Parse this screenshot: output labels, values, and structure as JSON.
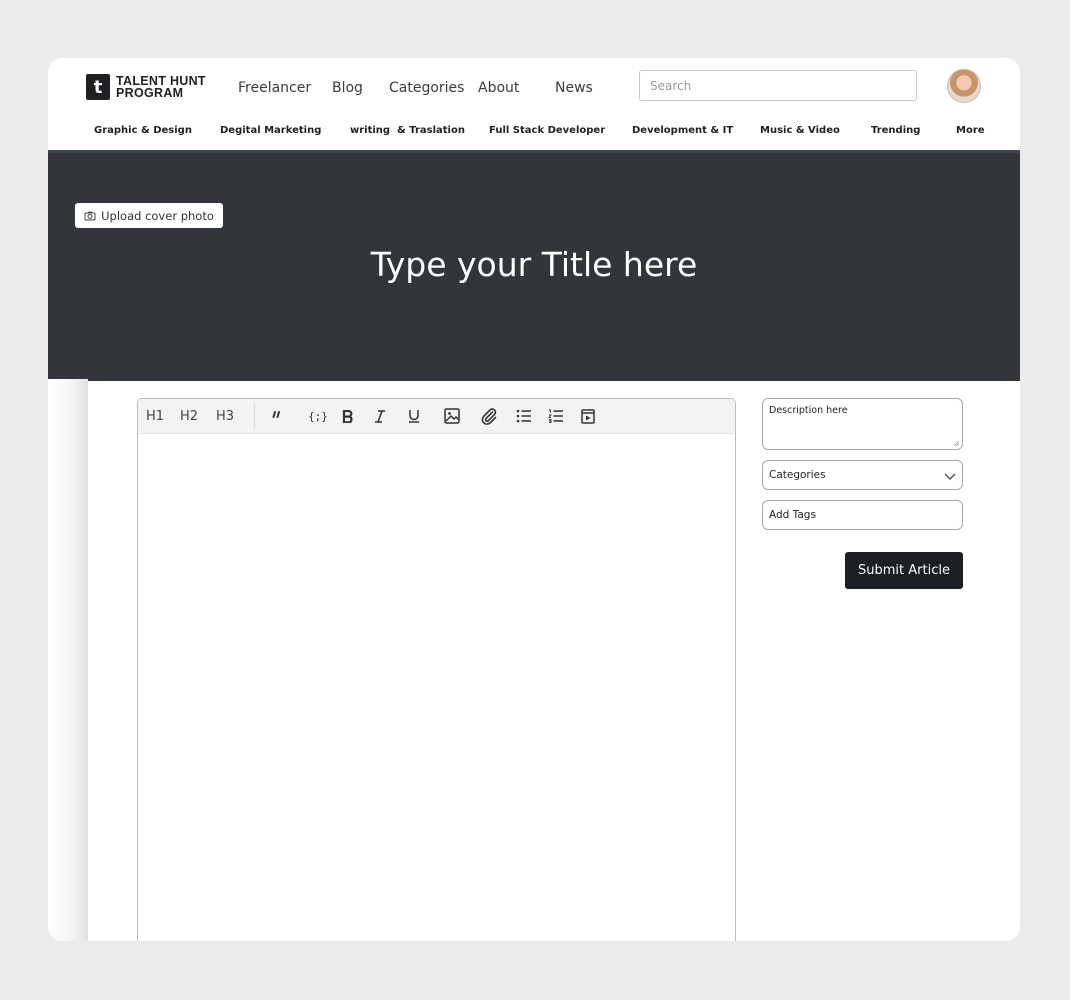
{
  "brand": {
    "mark": "t",
    "line1": "TALENT HUNT",
    "line2": "PROGRAM"
  },
  "nav": [
    "Freelancer",
    "Blog",
    "Categories",
    "About",
    "News"
  ],
  "search": {
    "placeholder": "Search"
  },
  "categories": [
    "Graphic & Design",
    "Degital Marketing",
    "writing  & Traslation",
    "Full Stack Developer",
    "Development & IT",
    "Music & Video",
    "Trending",
    "More"
  ],
  "cover": {
    "upload_label": "Upload cover photo",
    "title_placeholder": "Type your Title here"
  },
  "toolbar": {
    "h1": "H1",
    "h2": "H2",
    "h3": "H3",
    "code": "{;}"
  },
  "sidebar": {
    "description_placeholder": "Description here",
    "categories_label": "Categories",
    "tags_placeholder": "Add Tags",
    "submit_label": "Submit Article"
  },
  "colors": {
    "cover_bg": "#32363b",
    "primary_button": "#1c2026"
  }
}
